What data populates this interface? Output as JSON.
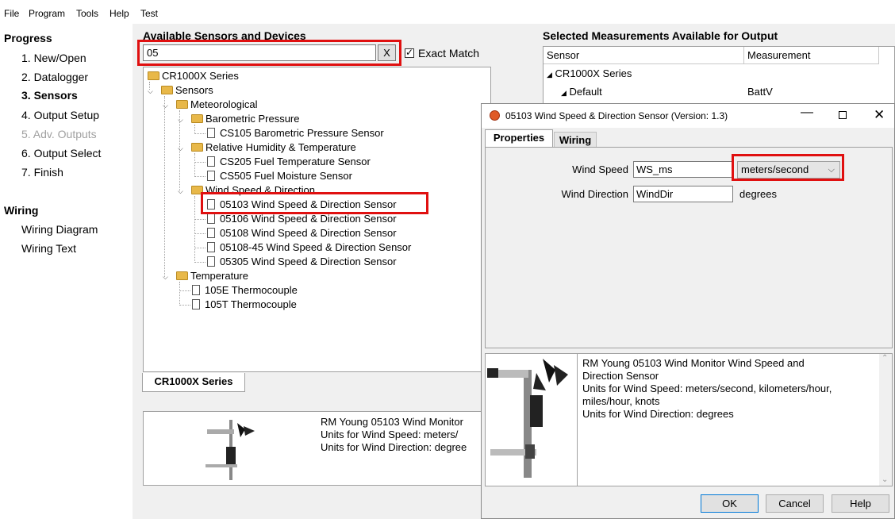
{
  "menu": [
    "File",
    "Program",
    "Tools",
    "Help",
    "Test"
  ],
  "nav": {
    "progress_heading": "Progress",
    "steps": [
      "1. New/Open",
      "2. Datalogger",
      "3. Sensors",
      "4. Output Setup",
      "5. Adv. Outputs",
      "6. Output Select",
      "7. Finish"
    ],
    "active_step": "3. Sensors",
    "disabled_step": "5. Adv. Outputs",
    "wiring_heading": "Wiring",
    "wiring_items": [
      "Wiring Diagram",
      "Wiring Text"
    ]
  },
  "sensors_panel": {
    "heading": "Available Sensors and Devices",
    "search_value": "05",
    "clear_label": "X",
    "exact_match_label": "Exact Match",
    "exact_match_checked": true,
    "tree": {
      "root": "CR1000X Series",
      "sensors": "Sensors",
      "meteorological": "Meteorological",
      "barometric": "Barometric Pressure",
      "cs105": "CS105 Barometric Pressure Sensor",
      "rh_temp": "Relative Humidity & Temperature",
      "cs205": "CS205 Fuel Temperature Sensor",
      "cs505": "CS505 Fuel Moisture Sensor",
      "wind": "Wind Speed & Direction",
      "w05103": "05103 Wind Speed & Direction Sensor",
      "w05106": "05106 Wind Speed & Direction Sensor",
      "w05108": "05108 Wind Speed & Direction Sensor",
      "w0510845": "05108-45 Wind Speed & Direction Sensor",
      "w05305": "05305 Wind Speed & Direction Sensor",
      "temperature": "Temperature",
      "t105e": "105E Thermocouple",
      "t105t": "105T Thermocouple"
    },
    "series_tab": "CR1000X Series",
    "description_lines": [
      "RM Young 05103 Wind Monitor",
      "Units for Wind Speed: meters/",
      "Units for Wind Direction: degree"
    ]
  },
  "selected": {
    "heading": "Selected Measurements Available for Output",
    "col_sensor": "Sensor",
    "col_measurement": "Measurement",
    "row1_sensor": "CR1000X Series",
    "row2_sensor": "Default",
    "row2_measurement": "BattV"
  },
  "dialog": {
    "title": "05103 Wind Speed & Direction Sensor (Version: 1.3)",
    "tab_properties": "Properties",
    "tab_wiring": "Wiring",
    "wind_speed_label": "Wind Speed",
    "wind_speed_value": "WS_ms",
    "wind_speed_unit": "meters/second",
    "wind_dir_label": "Wind Direction",
    "wind_dir_value": "WindDir",
    "wind_dir_unit": "degrees",
    "desc_lines": [
      "RM Young 05103 Wind Monitor Wind Speed and",
      "Direction Sensor",
      "Units for Wind Speed: meters/second, kilometers/hour,",
      "miles/hour, knots",
      "Units for Wind Direction: degrees"
    ],
    "ok": "OK",
    "cancel": "Cancel",
    "help": "Help"
  },
  "colors": {
    "highlight_red": "#e01010",
    "folder": "#e8b849"
  },
  "icons": [
    "folder-icon",
    "document-icon",
    "sensor-image",
    "minimize-icon",
    "maximize-icon",
    "close-icon",
    "chevron-down-icon"
  ]
}
